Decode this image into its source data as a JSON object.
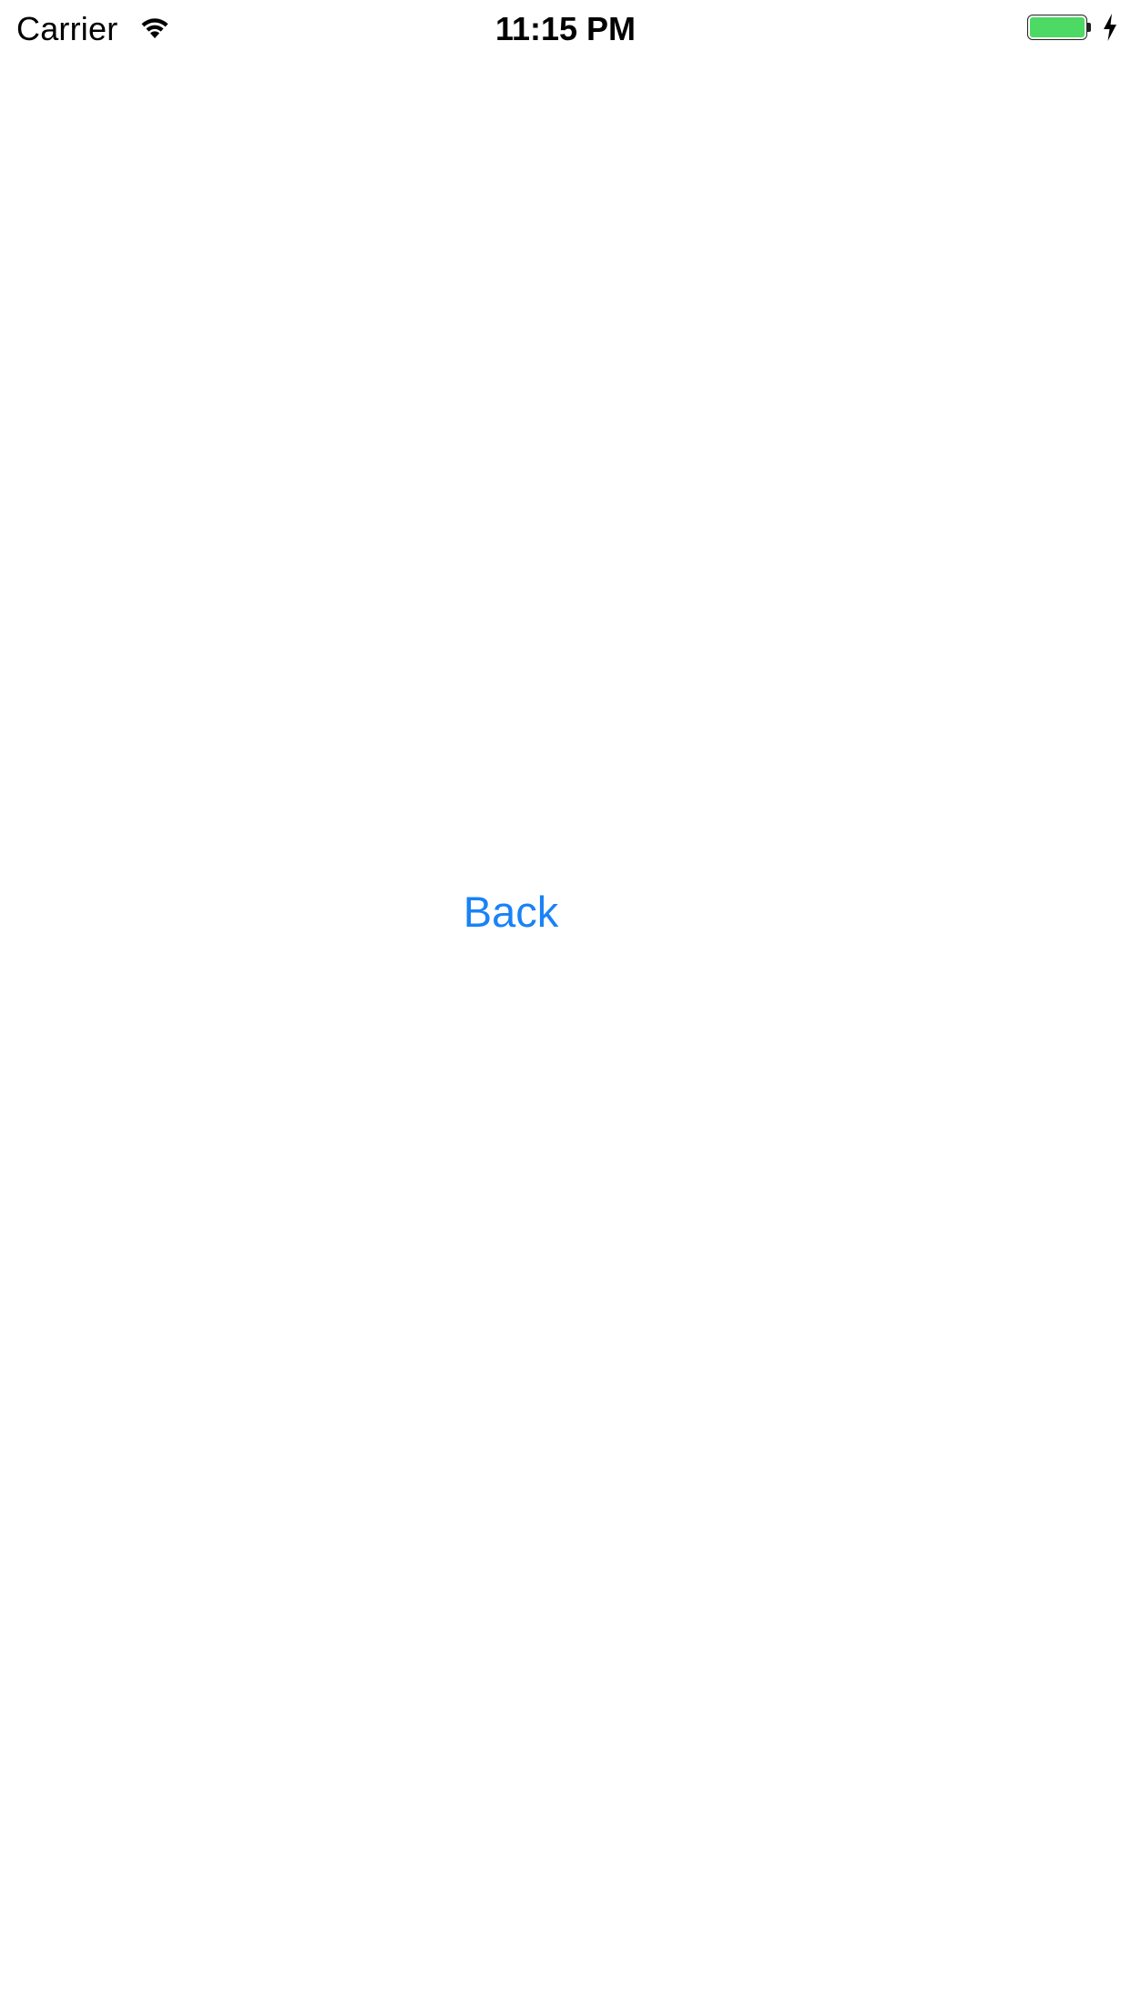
{
  "status_bar": {
    "carrier": "Carrier",
    "time": "11:15 PM",
    "wifi_icon": "wifi-icon",
    "battery_icon": "battery-icon",
    "charging_icon": "charging-bolt-icon",
    "battery_level": 1.0,
    "battery_color": "#4cd964"
  },
  "main": {
    "back_label": "Back",
    "accent_color": "#1a82f7"
  }
}
